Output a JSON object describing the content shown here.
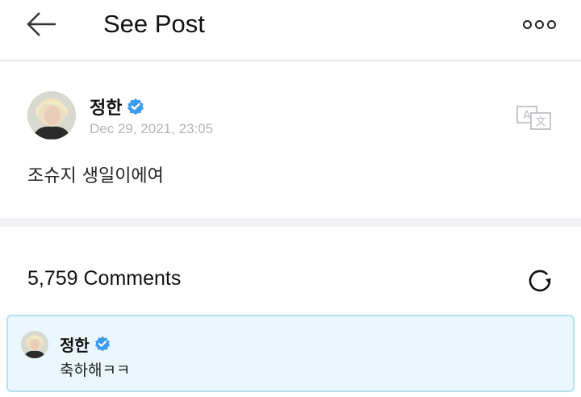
{
  "header": {
    "title": "See Post",
    "back_icon": "arrow-left-icon",
    "more_icon": "more-horizontal-icon"
  },
  "post": {
    "author": "정한",
    "verified_icon": "verified-badge-icon",
    "date": "Dec 29, 2021, 23:05",
    "text": "조슈지 생일이에여",
    "translate_icon": "translate-icon"
  },
  "comments": {
    "count_label": "5,759 Comments",
    "refresh_icon": "refresh-icon",
    "items": [
      {
        "author": "정한",
        "text": "축하해ㅋㅋ"
      }
    ]
  },
  "colors": {
    "verified": "#3b9cf0",
    "date_gray": "#b4b4bc",
    "comment_bg": "#eaf7fc",
    "comment_border": "#b6e2f0",
    "divider": "#f2f2f6"
  }
}
